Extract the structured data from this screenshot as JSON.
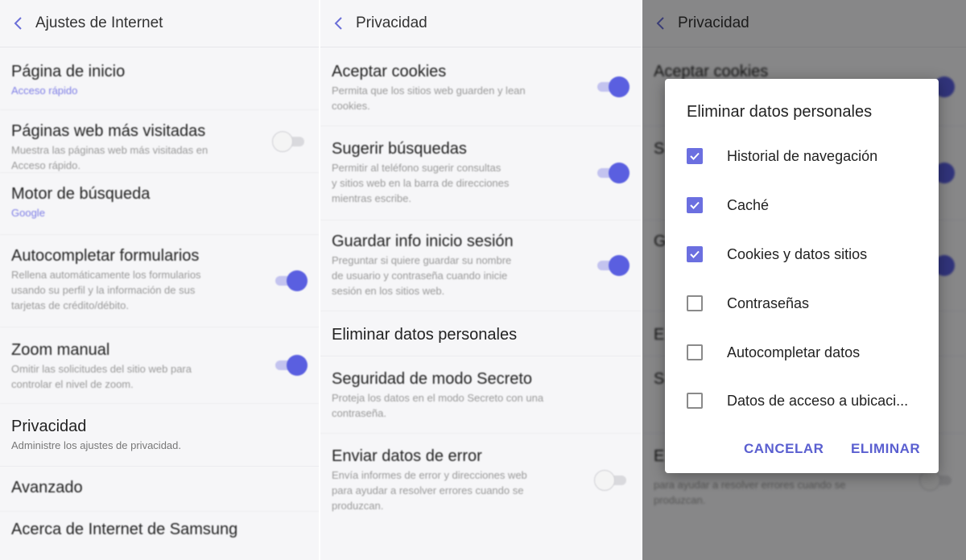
{
  "panel1": {
    "title": "Ajustes de Internet",
    "items": [
      {
        "title": "Página de inicio",
        "sub": "Acceso rápido"
      },
      {
        "title": "Páginas web más visitadas",
        "sub1": "Muestra las páginas web más visitadas en",
        "sub2": "Acceso rápido."
      },
      {
        "title": "Motor de búsqueda",
        "sub": "Google"
      },
      {
        "title": "Autocompletar formularios",
        "sub1": "Rellena automáticamente los formularios",
        "sub2": "usando su perfil y la información de sus",
        "sub3": "tarjetas de crédito/débito."
      },
      {
        "title": "Zoom manual",
        "sub1": "Omitir las solicitudes del sitio web para",
        "sub2": "controlar el nivel de zoom."
      },
      {
        "title": "Privacidad",
        "sub": "Administre los ajustes de privacidad."
      },
      {
        "title": "Avanzado"
      },
      {
        "title": "Acerca de Internet de Samsung"
      }
    ]
  },
  "panel2": {
    "title": "Privacidad",
    "items": [
      {
        "title": "Aceptar cookies",
        "sub1": "Permita que los sitios web guarden y lean",
        "sub2": "cookies."
      },
      {
        "title": "Sugerir búsquedas",
        "sub1": "Permitir al teléfono sugerir consultas",
        "sub2": "y sitios web en la barra de direcciones",
        "sub3": "mientras escribe."
      },
      {
        "title": "Guardar info inicio sesión",
        "sub1": "Preguntar si quiere guardar su nombre",
        "sub2": "de usuario y contraseña cuando inicie",
        "sub3": "sesión en los sitios web."
      },
      {
        "title": "Eliminar datos personales"
      },
      {
        "title": "Seguridad de modo Secreto",
        "sub1": "Proteja los datos en el modo Secreto con una",
        "sub2": "contraseña."
      },
      {
        "title": "Enviar datos de error",
        "sub1": "Envía informes de error y direcciones web",
        "sub2": "para ayudar a resolver errores cuando se",
        "sub3": "produzcan."
      }
    ]
  },
  "panel3": {
    "title": "Privacidad",
    "bg_items": [
      {
        "title": "Aceptar cookies"
      },
      {
        "letter": "S"
      },
      {
        "letter": "G"
      },
      {
        "letter": "E"
      },
      {
        "letter": "S"
      },
      {
        "letter": "E"
      }
    ],
    "bg_sub1": "para ayudar a resolver errores cuando se",
    "bg_sub2": "produzcan.",
    "dialog": {
      "title": "Eliminar datos personales",
      "options": [
        {
          "label": "Historial de navegación",
          "checked": true
        },
        {
          "label": "Caché",
          "checked": true
        },
        {
          "label": "Cookies y datos sitios",
          "checked": true
        },
        {
          "label": "Contraseñas",
          "checked": false
        },
        {
          "label": "Autocompletar datos",
          "checked": false
        },
        {
          "label": "Datos de acceso a ubicaci...",
          "checked": false
        }
      ],
      "cancel": "CANCELAR",
      "confirm": "ELIMINAR"
    }
  },
  "colors": {
    "accent": "#5a5fe0",
    "accent_light": "#c3c3ef"
  }
}
